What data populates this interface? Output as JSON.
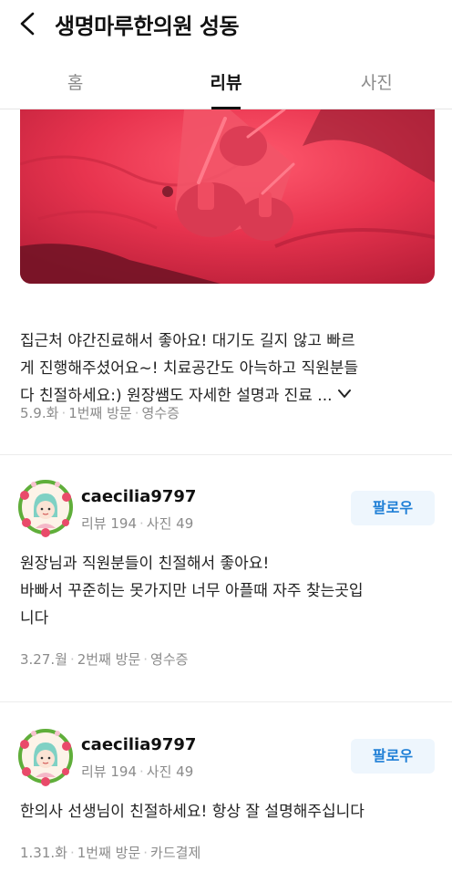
{
  "header": {
    "title": "생명마루한의원 성동"
  },
  "tabs": [
    {
      "label": "홈",
      "active": false
    },
    {
      "label": "리뷰",
      "active": true
    },
    {
      "label": "사진",
      "active": false
    }
  ],
  "reviews": [
    {
      "text": "집근처 야간진료해서 좋아요! 대기도 길지 않고 빠르\n게 진행해주셨어요~! 치료공간도 아늑하고 직원분들\n다 친절하세요:) 원장쌤도 자세한 설명과 진료 ...",
      "meta": {
        "date": "5.9.화",
        "visit": "1번째 방문",
        "verify": "영수증"
      }
    },
    {
      "user": {
        "name": "caecilia9797",
        "reviews": "리뷰 194",
        "photos": "사진 49"
      },
      "follow_label": "팔로우",
      "text": "원장님과 직원분들이 친절해서 좋아요!\n바빠서 꾸준히는 못가지만 너무 아플때 자주 찾는곳입\n니다",
      "meta": {
        "date": "3.27.월",
        "visit": "2번째 방문",
        "verify": "영수증"
      }
    },
    {
      "user": {
        "name": "caecilia9797",
        "reviews": "리뷰 194",
        "photos": "사진 49"
      },
      "follow_label": "팔로우",
      "text": "한의사 선생님이 친절하세요! 항상 잘 설명해주십니다",
      "meta": {
        "date": "1.31.화",
        "visit": "1번째 방문",
        "verify": "카드결제"
      }
    }
  ],
  "colors": {
    "follow_text": "#1f7fd6",
    "follow_bg": "#eef6fd",
    "photo_red": "#e8344f"
  }
}
